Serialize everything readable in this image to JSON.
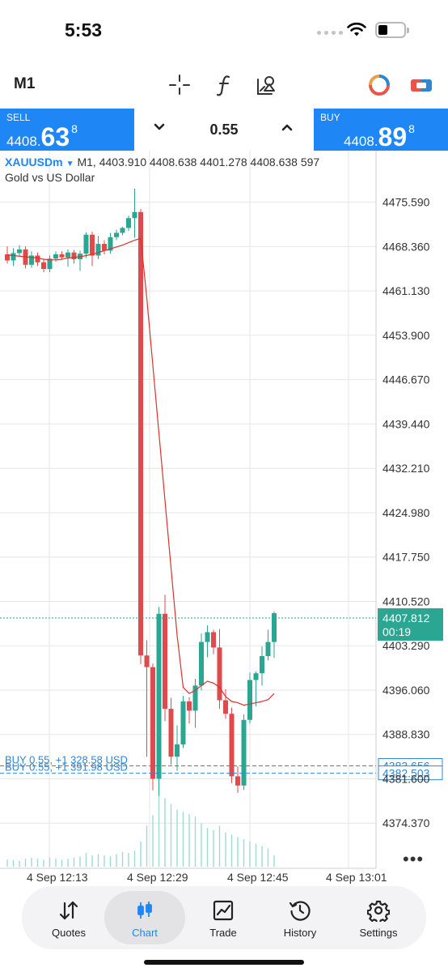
{
  "status_bar": {
    "time": "5:53"
  },
  "toolbar": {
    "timeframe": "M1",
    "icons": [
      "crosshair-icon",
      "indicators-icon",
      "objects-icon",
      "account-ring-icon",
      "trade-toggle-icon"
    ]
  },
  "trade_panel": {
    "sell": {
      "label": "SELL",
      "price_small": "4408.",
      "price_big": "63",
      "price_sup": "8"
    },
    "buy": {
      "label": "BUY",
      "price_small": "4408.",
      "price_big": "89",
      "price_sup": "8"
    },
    "volume": "0.55",
    "colors": {
      "accent": "#1e86f5"
    }
  },
  "chart_header": {
    "symbol": "XAUUSDm",
    "ohlc_line": "M1, 4403.910 4408.638 4401.278 4408.638 597",
    "description": "Gold vs US Dollar"
  },
  "chart_data": {
    "type": "candlestick",
    "y_ticks": [
      "4475.590",
      "4468.360",
      "4461.130",
      "4453.900",
      "4446.670",
      "4439.440",
      "4432.210",
      "4424.980",
      "4417.750",
      "4410.520",
      "4403.290",
      "4396.060",
      "4388.830",
      "4381.600",
      "4374.370"
    ],
    "x_ticks": [
      "4 Sep 12:13",
      "4 Sep 12:29",
      "4 Sep 12:45",
      "4 Sep 13:01"
    ],
    "ylim": [
      4367.0,
      4484.0
    ],
    "bid_price": "4407.812",
    "bid_timer": "00:19",
    "position_lines": [
      {
        "label": "BUY 0.55, +1 328.58 USD",
        "price": 4383.7,
        "tag": "4383.656"
      },
      {
        "label": "BUY 0.55, +1 391.98 USD",
        "price": 4382.5,
        "tag": "4382.503"
      }
    ],
    "candles": [
      {
        "o": 4467.1,
        "h": 4468.4,
        "l": 4465.6,
        "c": 4466.1
      },
      {
        "o": 4466.1,
        "h": 4468.1,
        "l": 4465.2,
        "c": 4467.3
      },
      {
        "o": 4467.3,
        "h": 4468.6,
        "l": 4466.8,
        "c": 4467.9
      },
      {
        "o": 4467.9,
        "h": 4468.4,
        "l": 4464.8,
        "c": 4465.4
      },
      {
        "o": 4465.4,
        "h": 4467.6,
        "l": 4464.9,
        "c": 4466.9
      },
      {
        "o": 4466.9,
        "h": 4467.4,
        "l": 4465.2,
        "c": 4465.8
      },
      {
        "o": 4465.8,
        "h": 4466.4,
        "l": 4464.2,
        "c": 4464.7
      },
      {
        "o": 4464.7,
        "h": 4466.9,
        "l": 4464.2,
        "c": 4466.4
      },
      {
        "o": 4466.4,
        "h": 4467.6,
        "l": 4465.9,
        "c": 4467.1
      },
      {
        "o": 4467.1,
        "h": 4467.6,
        "l": 4466.2,
        "c": 4466.6
      },
      {
        "o": 4466.6,
        "h": 4467.9,
        "l": 4465.1,
        "c": 4467.4
      },
      {
        "o": 4467.4,
        "h": 4467.8,
        "l": 4465.6,
        "c": 4466.3
      },
      {
        "o": 4466.3,
        "h": 4467.7,
        "l": 4464.4,
        "c": 4467.2
      },
      {
        "o": 4467.2,
        "h": 4470.7,
        "l": 4466.5,
        "c": 4470.3
      },
      {
        "o": 4470.3,
        "h": 4470.8,
        "l": 4465.2,
        "c": 4466.9
      },
      {
        "o": 4466.9,
        "h": 4470.1,
        "l": 4466.3,
        "c": 4468.8
      },
      {
        "o": 4468.8,
        "h": 4469.4,
        "l": 4467.1,
        "c": 4467.7
      },
      {
        "o": 4467.7,
        "h": 4470.6,
        "l": 4467.2,
        "c": 4469.9
      },
      {
        "o": 4469.9,
        "h": 4471.1,
        "l": 4469.4,
        "c": 4470.6
      },
      {
        "o": 4470.6,
        "h": 4471.6,
        "l": 4470.2,
        "c": 4471.4
      },
      {
        "o": 4471.4,
        "h": 4473.4,
        "l": 4470.9,
        "c": 4473.0
      },
      {
        "o": 4473.0,
        "h": 4477.8,
        "l": 4469.8,
        "c": 4474.0
      },
      {
        "o": 4474.0,
        "h": 4474.5,
        "l": 4400.3,
        "c": 4401.7
      },
      {
        "o": 4401.7,
        "h": 4404.2,
        "l": 4385.2,
        "c": 4399.8
      },
      {
        "o": 4399.8,
        "h": 4400.4,
        "l": 4379.7,
        "c": 4381.6
      },
      {
        "o": 4381.6,
        "h": 4409.6,
        "l": 4378.8,
        "c": 4408.5
      },
      {
        "o": 4408.5,
        "h": 4411.6,
        "l": 4391.0,
        "c": 4393.0
      },
      {
        "o": 4393.0,
        "h": 4394.8,
        "l": 4383.9,
        "c": 4385.2
      },
      {
        "o": 4385.2,
        "h": 4390.3,
        "l": 4382.9,
        "c": 4387.2
      },
      {
        "o": 4387.2,
        "h": 4395.1,
        "l": 4386.6,
        "c": 4394.2
      },
      {
        "o": 4394.2,
        "h": 4394.9,
        "l": 4390.6,
        "c": 4392.7
      },
      {
        "o": 4392.7,
        "h": 4397.9,
        "l": 4389.9,
        "c": 4396.8
      },
      {
        "o": 4396.8,
        "h": 4405.3,
        "l": 4396.0,
        "c": 4403.9
      },
      {
        "o": 4403.9,
        "h": 4406.6,
        "l": 4401.4,
        "c": 4405.5
      },
      {
        "o": 4405.5,
        "h": 4405.9,
        "l": 4401.9,
        "c": 4403.0
      },
      {
        "o": 4403.0,
        "h": 4406.0,
        "l": 4393.0,
        "c": 4394.4
      },
      {
        "o": 4394.4,
        "h": 4396.2,
        "l": 4391.4,
        "c": 4392.2
      },
      {
        "o": 4392.2,
        "h": 4393.2,
        "l": 4380.9,
        "c": 4382.0
      },
      {
        "o": 4382.0,
        "h": 4383.6,
        "l": 4379.3,
        "c": 4380.5
      },
      {
        "o": 4380.5,
        "h": 4392.1,
        "l": 4379.8,
        "c": 4391.2
      },
      {
        "o": 4391.2,
        "h": 4398.9,
        "l": 4390.6,
        "c": 4397.7
      },
      {
        "o": 4397.7,
        "h": 4399.1,
        "l": 4393.4,
        "c": 4398.8
      },
      {
        "o": 4398.8,
        "h": 4403.2,
        "l": 4396.8,
        "c": 4401.6
      },
      {
        "o": 4401.6,
        "h": 4405.9,
        "l": 4400.9,
        "c": 4403.9
      },
      {
        "o": 4403.9,
        "h": 4408.9,
        "l": 4401.3,
        "c": 4408.6
      }
    ],
    "ma": [
      4467.0,
      4466.9,
      4466.8,
      4466.7,
      4466.6,
      4466.5,
      4466.3,
      4466.2,
      4466.2,
      4466.3,
      4466.5,
      4466.6,
      4466.7,
      4466.9,
      4467.1,
      4467.4,
      4467.7,
      4468.0,
      4468.3,
      4468.6,
      4469.0,
      4469.4,
      4469.7,
      4460.0,
      4449.0,
      4438.0,
      4427.0,
      4416.0,
      4405.0,
      4396.5,
      4395.5,
      4396.0,
      4396.8,
      4397.5,
      4397.2,
      4396.5,
      4395.0,
      4394.2,
      4394.0,
      4393.6,
      4393.8,
      4394.0,
      4394.2,
      4394.5,
      4395.5
    ],
    "volumes": [
      6,
      6,
      5,
      7,
      8,
      7,
      6,
      8,
      7,
      6,
      7,
      8,
      9,
      12,
      10,
      11,
      10,
      9,
      11,
      13,
      12,
      14,
      22,
      36,
      45,
      78,
      60,
      55,
      50,
      48,
      46,
      44,
      38,
      34,
      32,
      36,
      30,
      28,
      26,
      24,
      22,
      20,
      18,
      16,
      10
    ],
    "colors": {
      "up": "#2aa693",
      "down": "#e14a4d",
      "ma": "#d9332b",
      "volume": "#9ddbd1",
      "grid": "#e6e6e6",
      "bid": "#2aa693",
      "position": "#2f86d4"
    }
  },
  "chart_footer": {
    "more_label": "•••"
  },
  "tab_bar": {
    "tabs": [
      {
        "label": "Quotes",
        "icon": "quotes-arrows-icon",
        "active": false
      },
      {
        "label": "Chart",
        "icon": "candlestick-icon",
        "active": true
      },
      {
        "label": "Trade",
        "icon": "trade-chart-icon",
        "active": false
      },
      {
        "label": "History",
        "icon": "history-clock-icon",
        "active": false
      },
      {
        "label": "Settings",
        "icon": "settings-gear-icon",
        "active": false
      }
    ]
  }
}
